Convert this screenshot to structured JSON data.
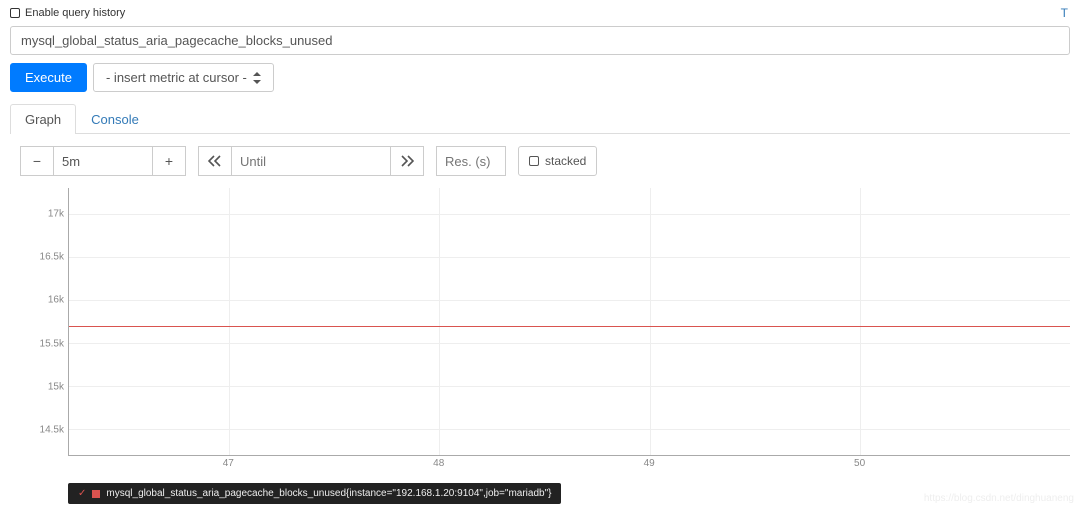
{
  "history_label": "Enable query history",
  "top_right": "T",
  "expression_input": {
    "value": "mysql_global_status_aria_pagecache_blocks_unused",
    "placeholder": ""
  },
  "execute_label": "Execute",
  "metric_dropdown": "- insert metric at cursor -",
  "tabs": {
    "graph": "Graph",
    "console": "Console"
  },
  "controls": {
    "duration": "5m",
    "until_placeholder": "Until",
    "res_placeholder": "Res. (s)",
    "stacked_label": "stacked"
  },
  "legend": {
    "text": "mysql_global_status_aria_pagecache_blocks_unused{instance=\"192.168.1.20:9104\",job=\"mariadb\"}"
  },
  "watermark": "https://blog.csdn.net/dinghuaneng",
  "chart_data": {
    "type": "line",
    "y_ticks": [
      14.5,
      15,
      15.5,
      16,
      16.5,
      17
    ],
    "y_tick_labels": [
      "14.5k",
      "15k",
      "15.5k",
      "16k",
      "16.5k",
      "17k"
    ],
    "ylim": [
      14.2,
      17.3
    ],
    "x_tick_positions_pct": [
      16,
      37,
      58,
      79
    ],
    "x_tick_labels": [
      "47",
      "48",
      "49",
      "50"
    ],
    "series": [
      {
        "name": "mysql_global_status_aria_pagecache_blocks_unused",
        "value_k": 15.7,
        "color": "#d9534f"
      }
    ]
  }
}
